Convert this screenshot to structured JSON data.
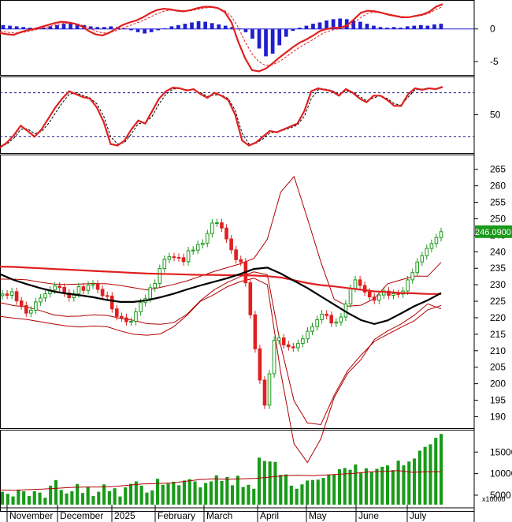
{
  "chart_data": [
    {
      "type": "bar",
      "panel": "macd",
      "y_ticks": [
        "0",
        "-5"
      ],
      "y_tick_values": [
        0,
        -5
      ],
      "ylim": [
        -6.8,
        4.2
      ],
      "series": [
        {
          "name": "",
          "style": "histogram",
          "color": "#1f1fcf",
          "values": [
            0.6,
            0.5,
            0.4,
            0.3,
            0.2,
            0.1,
            0.2,
            0.4,
            0.6,
            0.8,
            0.9,
            0.8,
            0.6,
            0.4,
            0.3,
            0.3,
            0.4,
            0.3,
            0.1,
            -0.2,
            -0.5,
            -0.7,
            -0.5,
            -0.2,
            0.1,
            0.4,
            0.6,
            0.8,
            1.0,
            1.2,
            1.1,
            0.9,
            0.7,
            0.5,
            0.3,
            0.1,
            -0.5,
            -1.5,
            -3.0,
            -4.2,
            -3.8,
            -2.5,
            -1.2,
            -0.3,
            0.2,
            0.5,
            0.8,
            1.0,
            1.3,
            1.5,
            1.6,
            1.5,
            1.3,
            1.1,
            0.8,
            0.5,
            0.3,
            0.2,
            0.3,
            0.2,
            0.4,
            0.5,
            0.6,
            0.5,
            0.7,
            0.8
          ]
        },
        {
          "name": "",
          "style": "line",
          "color": "#e02020",
          "values": [
            -0.6,
            -0.8,
            -0.9,
            -0.5,
            -0.2,
            0.0,
            0.3,
            0.6,
            0.9,
            1.1,
            1.0,
            0.8,
            0.4,
            -0.3,
            -0.8,
            -1.0,
            -0.6,
            0.0,
            0.6,
            1.0,
            1.3,
            1.8,
            2.4,
            2.9,
            3.1,
            3.0,
            2.8,
            2.7,
            2.9,
            3.2,
            3.4,
            3.4,
            3.2,
            2.6,
            1.0,
            -2.0,
            -4.5,
            -6.3,
            -6.5,
            -6.1,
            -5.3,
            -4.4,
            -3.6,
            -2.8,
            -2.1,
            -1.6,
            -1.0,
            -0.3,
            0.0,
            0.2,
            0.2,
            0.6,
            1.5,
            2.5,
            2.8,
            2.7,
            2.5,
            2.2,
            2.0,
            1.8,
            1.8,
            2.0,
            2.2,
            2.6,
            3.4,
            3.8
          ]
        },
        {
          "name": "",
          "style": "dashed",
          "color": "#e02020",
          "values": [
            -0.3,
            -0.5,
            -0.6,
            -0.6,
            -0.4,
            -0.2,
            0.1,
            0.3,
            0.6,
            0.8,
            0.9,
            0.8,
            0.6,
            0.2,
            -0.3,
            -0.6,
            -0.6,
            -0.3,
            0.1,
            0.5,
            0.9,
            1.3,
            1.8,
            2.3,
            2.7,
            2.9,
            2.9,
            2.8,
            2.8,
            3.0,
            3.2,
            3.3,
            3.2,
            2.8,
            1.9,
            0.2,
            -2.0,
            -3.8,
            -5.0,
            -5.6,
            -5.5,
            -5.0,
            -4.3,
            -3.5,
            -2.8,
            -2.2,
            -1.6,
            -0.9,
            -0.4,
            -0.1,
            0.1,
            0.3,
            0.9,
            1.8,
            2.4,
            2.6,
            2.5,
            2.3,
            2.1,
            1.9,
            1.8,
            1.9,
            2.1,
            2.4,
            3.0,
            3.4
          ]
        }
      ]
    },
    {
      "type": "line",
      "panel": "oscillator",
      "y_ticks": [
        "50"
      ],
      "y_tick_values": [
        50
      ],
      "ylim": [
        0,
        100
      ],
      "reference_lines": [
        80,
        20
      ],
      "series": [
        {
          "name": "",
          "style": "line",
          "color": "#e02020",
          "values": [
            5,
            12,
            22,
            35,
            28,
            20,
            30,
            45,
            60,
            72,
            82,
            78,
            74,
            72,
            60,
            40,
            10,
            8,
            15,
            30,
            42,
            38,
            55,
            72,
            82,
            87,
            86,
            83,
            85,
            78,
            73,
            80,
            76,
            70,
            50,
            15,
            8,
            12,
            20,
            28,
            26,
            30,
            34,
            38,
            55,
            82,
            86,
            84,
            82,
            76,
            85,
            80,
            72,
            67,
            76,
            76,
            70,
            62,
            62,
            78,
            86,
            84,
            86,
            85,
            88
          ]
        },
        {
          "name": "",
          "style": "dashed",
          "color": "#000000",
          "values": [
            7,
            10,
            18,
            30,
            31,
            24,
            27,
            38,
            52,
            66,
            78,
            80,
            76,
            73,
            65,
            48,
            20,
            10,
            12,
            24,
            38,
            39,
            48,
            65,
            78,
            85,
            86,
            84,
            84,
            80,
            75,
            77,
            77,
            72,
            56,
            25,
            10,
            11,
            17,
            25,
            27,
            29,
            32,
            36,
            48,
            72,
            84,
            85,
            83,
            78,
            82,
            81,
            75,
            69,
            73,
            76,
            72,
            65,
            63,
            74,
            84,
            85,
            86,
            85,
            87
          ]
        }
      ]
    },
    {
      "type": "line",
      "panel": "price",
      "y_ticks": [
        "265",
        "260",
        "255",
        "250",
        "245",
        "240",
        "235",
        "230",
        "225",
        "220",
        "215",
        "210",
        "205",
        "200",
        "195",
        "190"
      ],
      "y_tick_values": [
        265,
        260,
        255,
        250,
        245,
        240,
        235,
        230,
        225,
        220,
        215,
        210,
        205,
        200,
        195,
        190
      ],
      "ylim": [
        187,
        269
      ],
      "last_price": "246.0900",
      "candles_close": [
        227.2,
        226.8,
        227.9,
        225.1,
        223.7,
        221.4,
        222.3,
        224.8,
        226.0,
        227.3,
        228.4,
        229.6,
        229.2,
        227.5,
        226.1,
        227.3,
        229.4,
        228.3,
        229.9,
        230.2,
        228.6,
        226.7,
        226.6,
        222.7,
        220.4,
        220.0,
        218.8,
        218.9,
        221.8,
        224.6,
        225.8,
        229.1,
        230.4,
        234.9,
        237.7,
        238.5,
        238.3,
        238.2,
        237.0,
        240.3,
        240.5,
        242.2,
        242.6,
        245.5,
        248.7,
        248.8,
        247.2,
        243.9,
        240.6,
        237.6,
        236.9,
        230.6,
        220.9,
        210.6,
        201.1,
        193.5,
        203.0,
        213.1,
        213.9,
        211.8,
        211.2,
        210.9,
        212.2,
        213.6,
        215.9,
        217.3,
        219.4,
        221.1,
        220.7,
        218.4,
        218.7,
        220.2,
        224.2,
        228.9,
        231.5,
        229.8,
        227.8,
        226.3,
        225.3,
        226.9,
        228.1,
        226.8,
        227.3,
        227.2,
        228.1,
        231.5,
        233.7,
        236.9,
        238.8,
        241.0,
        242.5,
        244.3,
        246.1
      ],
      "series": [
        {
          "name": "",
          "style": "line",
          "color": "#e02020",
          "values": [
            235.5,
            235.4,
            235.2,
            235.0,
            234.8,
            234.6,
            234.4,
            234.2,
            234.0,
            233.8,
            233.6,
            233.4,
            233.3,
            233.2,
            233.1,
            233.0,
            233.0,
            232.9,
            232.9,
            232.8,
            232.6,
            232.2,
            231.4,
            230.5,
            229.9,
            229.5,
            229.0,
            228.5,
            228.0,
            227.8,
            227.5,
            227.4,
            227.2,
            227.2
          ]
        },
        {
          "name": "",
          "style": "line",
          "color": "#000000",
          "values": [
            233.2,
            231.5,
            230.2,
            229.0,
            228.0,
            227.3,
            226.8,
            226.2,
            225.4,
            224.8,
            224.8,
            225.3,
            226.2,
            227.3,
            228.6,
            229.8,
            230.9,
            232.0,
            233.3,
            234.8,
            235.2,
            233.4,
            231.2,
            229.0,
            226.5,
            224.0,
            221.5,
            219.3,
            218.1,
            219.2,
            221.3,
            223.5,
            225.3,
            227.5
          ]
        },
        {
          "name": "",
          "style": "line",
          "color": "#b00000",
          "values": [
            231.7,
            231.7,
            231.5,
            230.8,
            230.2,
            230.1,
            230.2,
            230.4,
            230.3,
            229.8,
            229.1,
            228.4,
            229.2,
            230.1,
            231.2,
            232.6,
            234.0,
            235.2,
            236.4,
            238.0,
            243.8,
            258.1,
            262.8,
            250.1,
            236.9,
            225.6,
            223.5,
            223.8,
            225.8,
            230.3,
            231.5,
            232.6,
            232.6,
            236.8
          ]
        },
        {
          "name": "",
          "style": "line",
          "color": "#b00000",
          "values": [
            224.6,
            223.7,
            223.3,
            222.2,
            220.9,
            220.4,
            220.5,
            220.9,
            220.7,
            219.8,
            219.2,
            218.2,
            218.0,
            218.5,
            221.1,
            225.2,
            228.4,
            230.7,
            232.5,
            233.9,
            233.0,
            211.6,
            194.8,
            188.1,
            187.6,
            196.5,
            203.9,
            208.6,
            212.8,
            215.0,
            217.1,
            219.1,
            222.4,
            223.7
          ]
        },
        {
          "name": "",
          "style": "line",
          "color": "#b00000",
          "values": [
            220.4,
            219.9,
            219.5,
            218.8,
            218.1,
            217.5,
            217.2,
            217.5,
            217.3,
            216.0,
            215.0,
            214.7,
            215.1,
            217.3,
            220.8,
            225.0,
            227.0,
            229.4,
            231.0,
            232.0,
            230.0,
            203.4,
            181.8,
            176.1,
            183.3,
            195.8,
            203.1,
            207.3,
            213.4,
            216.0,
            218.1,
            220.8,
            224.2,
            222.7
          ]
        }
      ]
    },
    {
      "type": "bar",
      "panel": "volume",
      "y_ticks": [
        "15000",
        "10000",
        "5000"
      ],
      "y_tick_values": [
        15000,
        10000,
        5000
      ],
      "ylim": [
        2800,
        19800
      ],
      "unit_label": "x10000",
      "x_tick_labels": [
        "November",
        "December",
        "2025",
        "February",
        "March",
        "April",
        "May",
        "June",
        "July"
      ],
      "series": [
        {
          "name": "",
          "style": "bars",
          "color": "#1a9a1a",
          "values": [
            5800,
            5300,
            4700,
            6300,
            5900,
            4800,
            5900,
            5600,
            4400,
            7200,
            8500,
            6200,
            5400,
            5900,
            7600,
            5500,
            6900,
            4800,
            5800,
            7500,
            5900,
            6600,
            4700,
            6800,
            7600,
            8200,
            7200,
            5600,
            6100,
            8800,
            7400,
            7700,
            8100,
            7300,
            8400,
            8700,
            8200,
            6800,
            7800,
            8200,
            9600,
            8300,
            9200,
            7300,
            9500,
            6900,
            7400,
            6500,
            13700,
            12900,
            12800,
            12700,
            9700,
            9800,
            7200,
            6500,
            7500,
            8400,
            8500,
            8600,
            9000,
            9700,
            9800,
            11000,
            11300,
            10900,
            12100,
            10100,
            11200,
            10300,
            11100,
            11600,
            11900,
            10800,
            13000,
            11900,
            12800,
            13500,
            15300,
            16200,
            16800,
            18300,
            19200
          ]
        },
        {
          "name": "",
          "style": "line",
          "color": "#b00000",
          "values": [
            6200,
            6100,
            6300,
            6400,
            6600,
            6800,
            6900,
            6900,
            7000,
            7300,
            7600,
            7700,
            7800,
            8200,
            8600,
            8800,
            8700,
            8800,
            8900,
            9200,
            9500,
            9600,
            9500,
            9700,
            9900,
            10100,
            10400,
            10500,
            10700,
            10300,
            10400,
            10400
          ]
        }
      ]
    }
  ]
}
